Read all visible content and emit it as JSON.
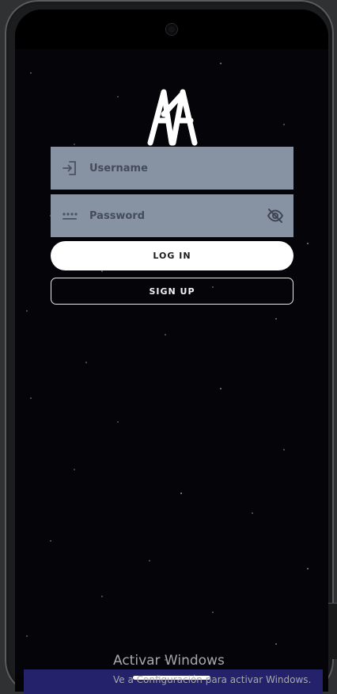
{
  "app": {
    "logo_text": "AKA"
  },
  "login_form": {
    "username": {
      "placeholder": "Username",
      "value": "",
      "icon": "login-icon"
    },
    "password": {
      "placeholder": "Password",
      "value": "",
      "icon": "password-dots-icon",
      "toggle_icon": "eye-off-icon"
    },
    "login_label": "LOG IN",
    "signup_label": "SIGN UP"
  },
  "os_overlay": {
    "title": "Activar Windows",
    "subtitle": "Ve a Configuración para activar Windows."
  },
  "colors": {
    "field_bg": "#8792a2",
    "login_bg": "#ffffff",
    "nav_strip": "#24226b",
    "background": "#050509"
  }
}
